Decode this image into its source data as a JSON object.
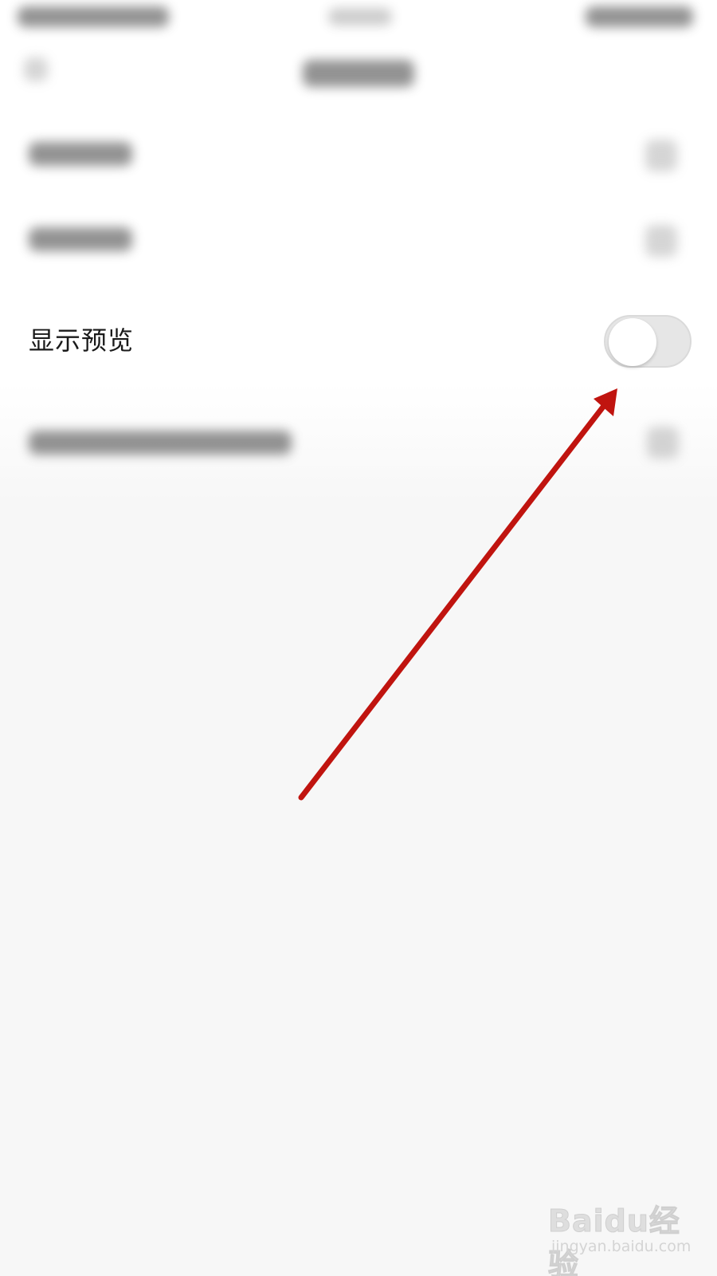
{
  "setting": {
    "label": "显示预览",
    "toggle_state": "off"
  },
  "annotation": {
    "color": "#c0140f",
    "description": "arrow-pointing-to-toggle"
  },
  "watermark": {
    "main": "Baidu经验",
    "sub": "jingyan.baidu.com"
  },
  "colors": {
    "background": "#f7f7f7",
    "row_background": "#ffffff",
    "toggle_track": "#e6e6e6",
    "toggle_knob": "#ffffff",
    "text": "#1a1a1a"
  }
}
